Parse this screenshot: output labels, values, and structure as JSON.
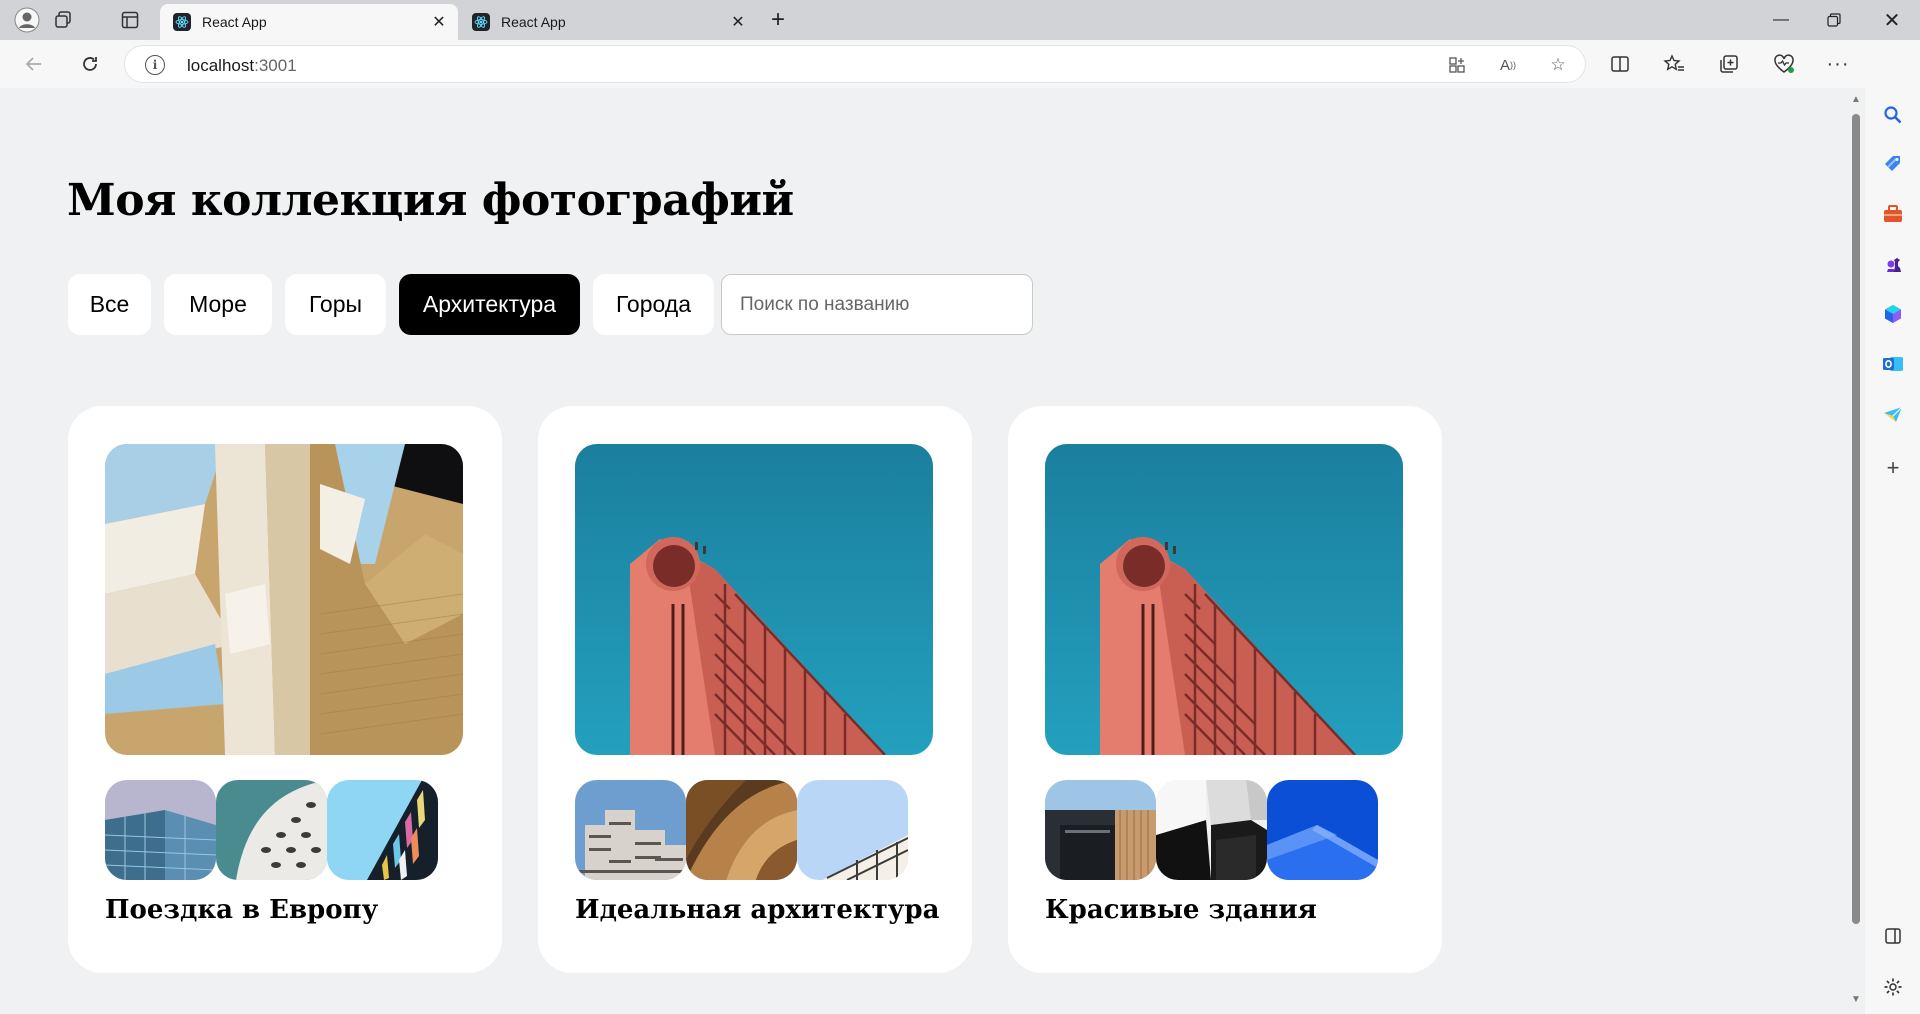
{
  "browser": {
    "tabs": [
      {
        "title": "React App",
        "active": true
      },
      {
        "title": "React App",
        "active": false
      }
    ],
    "address": {
      "host": "localhost",
      "port": ":3001"
    }
  },
  "page": {
    "title": "Моя коллекция фотографий",
    "filters": [
      "Все",
      "Море",
      "Горы",
      "Архитектура",
      "Города"
    ],
    "active_filter": "Архитектура",
    "search": {
      "value": "",
      "placeholder": "Поиск по названию"
    },
    "collections": [
      {
        "name": "Поездка в Европу"
      },
      {
        "name": "Идеальная архитектура"
      },
      {
        "name": "Красивые здания"
      }
    ]
  },
  "colors": {
    "accent": "#000000",
    "page_bg": "#f0f1f2",
    "card_bg": "#ffffff"
  }
}
